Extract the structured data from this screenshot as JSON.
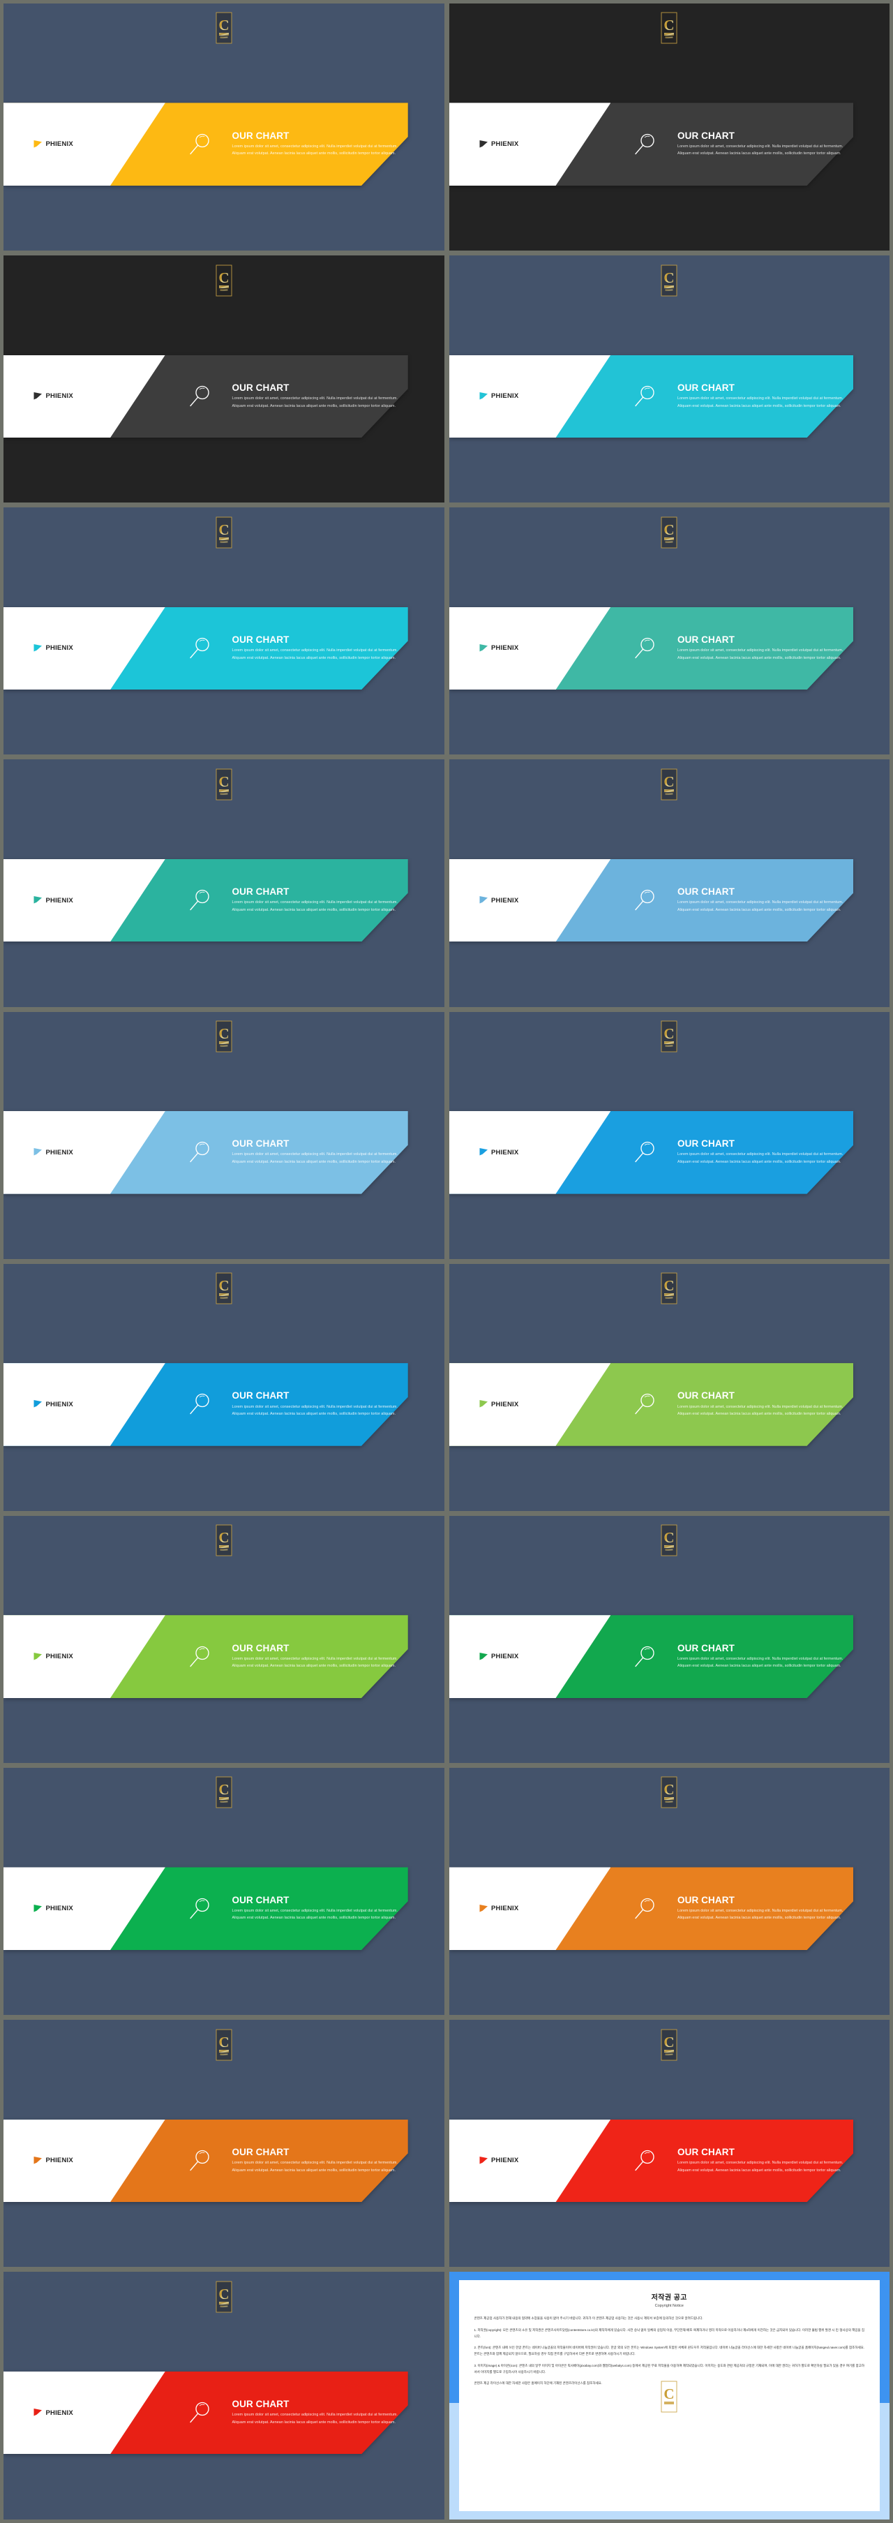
{
  "deck": {
    "background_color": "#44536b",
    "dark_background_color": "#232323",
    "gutter_color": "#6e7169",
    "brand": "PHIENIX",
    "heading": "OUR CHART",
    "body": "Lorem ipsum dolor sit amet, consectetur adipiscing elit. Nulla imperdiet volutpat dui at fermentum. Aliquam erat volutpat. Aenean lacinia lacus aliquet ante mollis, sollicitudin tempor tortor aliquam.",
    "watermark_letter": "C",
    "watermark_sub": "STUDY",
    "slides": [
      {
        "index": 1,
        "accent": "#fdb913",
        "theme": "blue"
      },
      {
        "index": 2,
        "accent": "#3d3d3d",
        "theme": "dark"
      },
      {
        "index": 3,
        "accent": "#3d3d3d",
        "theme": "dark"
      },
      {
        "index": 4,
        "accent": "#22c3d6",
        "theme": "blue"
      },
      {
        "index": 5,
        "accent": "#1cc5d8",
        "theme": "blue"
      },
      {
        "index": 6,
        "accent": "#3fb8a5",
        "theme": "blue"
      },
      {
        "index": 7,
        "accent": "#2bb39f",
        "theme": "blue"
      },
      {
        "index": 8,
        "accent": "#6cb3dd",
        "theme": "blue"
      },
      {
        "index": 9,
        "accent": "#7cc0e5",
        "theme": "blue"
      },
      {
        "index": 10,
        "accent": "#1a9fe0",
        "theme": "blue"
      },
      {
        "index": 11,
        "accent": "#119ddb",
        "theme": "blue"
      },
      {
        "index": 12,
        "accent": "#8dc84e",
        "theme": "blue"
      },
      {
        "index": 13,
        "accent": "#86c93f",
        "theme": "blue"
      },
      {
        "index": 14,
        "accent": "#12a84e",
        "theme": "blue"
      },
      {
        "index": 15,
        "accent": "#0cb04f",
        "theme": "blue"
      },
      {
        "index": 16,
        "accent": "#e8801f",
        "theme": "blue"
      },
      {
        "index": 17,
        "accent": "#e4761a",
        "theme": "blue"
      },
      {
        "index": 18,
        "accent": "#ef2418",
        "theme": "blue"
      },
      {
        "index": 19,
        "accent": "#e82015",
        "theme": "blue"
      }
    ]
  },
  "copyright": {
    "title": "저작권 공고",
    "subtitle": "Copyright Notice",
    "paragraphs": [
      "콘텐츠 제공업 사용자가 현재 내용의 협약에 소장물을 사용이 없어 주시기 바랍니다. 귀하가 이 콘텐츠 제공업 사용하는 것은 사용시 계약서 보증에 동의하신 것으로 알려드립니다.",
      "1. 저작권(copyright): 모든 콘텐츠의 소유 및 저작권은 콘텐츠사이트닷컴(contentstore.co.kr)의 제작자에게 있습니다. 사전 승낙 없이 일체의 상업적 이용, 무단전재·배포·복제하거나 영리 목적으로 이용하거나 제3자에게 이전하는 것은 금지되어 있습니다. 이러한 불법 행위 발견 시 민·형사상의 책임을 집니다.",
      "2. 폰트(font): 콘텐츠 내에 쓰인 한글 폰트는 네이버 나눔글꼴의 저작물이며 네이버에 저작권이 있습니다. 한글 외의 모든 폰트는 Windows System에 포함된 서체로 윈도우즈 저작물입니다. 네이버 나눔글꼴 라이선스에 대한 자세한 사항은 네이버 나눔글꼴 홈페이지(hangeul.naver.com)를 참조하세요. 폰트는 콘텐츠와 함께 제공되지 않으므로, 필요하실 경우 직접 폰트를 구입하셔서 다른 폰트로 변경하여 사용하시기 바랍니다.",
      "3. 이미지(image) & 아이콘(icon): 콘텐츠 내의 일부 이미지 및 아이콘은 픽사베이(pixabay.com)와 웹얼리(webalys.com) 등에서 제공된 무료 저작물을 이용하여 제작되었습니다. 이미지는 용도와 관련 제공처의 규정만 기재되며, 이에 대한 권리는 귀하가 별도로 확인하실 필요가 있을 경우 여기를 참고하셔서 이미지를 별도로 구입하시어 사용하시기 바랍니다.",
      "콘텐츠 제공 라이선스에 대한 자세한 사항은 홈페이지 하단에 기재된 콘텐츠라이선스를 참조하세요."
    ]
  }
}
